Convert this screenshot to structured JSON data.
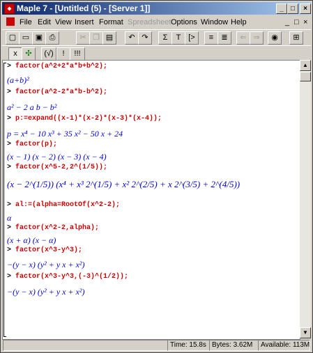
{
  "window": {
    "title": "Maple 7 - [Untitled (5) - [Server 1]]",
    "buttons": {
      "minimize": "_",
      "maximize": "□",
      "close": "×"
    }
  },
  "menu": {
    "items": [
      "File",
      "Edit",
      "View",
      "Insert",
      "Format",
      "Spreadsheet",
      "Options",
      "Window",
      "Help"
    ],
    "disabled": [
      "Spreadsheet"
    ],
    "doc_controls": [
      "_",
      "□",
      "×"
    ]
  },
  "toolbar1": {
    "buttons": [
      {
        "name": "new-document-button",
        "glyph": "▢"
      },
      {
        "name": "open-button",
        "glyph": "▭"
      },
      {
        "name": "save-button",
        "glyph": "▣"
      },
      {
        "name": "print-button",
        "glyph": "⎙"
      },
      {
        "name": "cut-button",
        "glyph": "✂"
      },
      {
        "name": "copy-button",
        "glyph": "❐"
      },
      {
        "name": "paste-button",
        "glyph": "▤"
      },
      {
        "name": "undo-button",
        "glyph": "↶"
      },
      {
        "name": "redo-button",
        "glyph": "↷"
      },
      {
        "name": "insert-math-button",
        "glyph": "Σ"
      },
      {
        "name": "insert-text-button",
        "glyph": "T"
      },
      {
        "name": "insert-prompt-button",
        "glyph": "[>"
      },
      {
        "name": "indent-button",
        "glyph": "≡"
      },
      {
        "name": "outdent-button",
        "glyph": "≣"
      },
      {
        "name": "back-button",
        "glyph": "⇐"
      },
      {
        "name": "forward-button",
        "glyph": "⇒"
      },
      {
        "name": "stop-button",
        "glyph": "◉"
      },
      {
        "name": "restart-button",
        "glyph": "⊞"
      }
    ]
  },
  "toolbar2": {
    "buttons": [
      {
        "name": "maple-notation-button",
        "glyph": "x"
      },
      {
        "name": "standard-math-button",
        "glyph": "✣"
      },
      {
        "name": "execute-button",
        "glyph": "(√)"
      },
      {
        "name": "execute-worksheet-button",
        "glyph": "!"
      },
      {
        "name": "execute-all-button",
        "glyph": "!!!"
      }
    ]
  },
  "worksheet": {
    "lines": [
      {
        "kind": "in",
        "text": "factor(a^2+2*a*b+b^2);"
      },
      {
        "kind": "out",
        "text": "(a+b)²"
      },
      {
        "kind": "in",
        "text": "factor(a^2-2*a*b-b^2);"
      },
      {
        "kind": "out",
        "text": "a² − 2 a b − b²"
      },
      {
        "kind": "in",
        "text": "p:=expand((x-1)*(x-2)*(x-3)*(x-4));"
      },
      {
        "kind": "out",
        "text": "p = x⁴ − 10 x³ + 35 x² − 50 x + 24"
      },
      {
        "kind": "in",
        "text": "factor(p);"
      },
      {
        "kind": "out",
        "text": "(x − 1) (x − 2) (x − 3) (x − 4)"
      },
      {
        "kind": "in",
        "text": "factor(x^5-2,2^(1/5));"
      },
      {
        "kind": "out",
        "text": "(x − 2^(1/5)) (x⁴ + x³ 2^(1/5) + x² 2^(2/5) + x 2^(3/5) + 2^(4/5))"
      },
      {
        "kind": "in",
        "text": "al:=(alpha=RootOf(x^2-2);"
      },
      {
        "kind": "out",
        "text": "α"
      },
      {
        "kind": "in",
        "text": "factor(x^2-2,alpha);"
      },
      {
        "kind": "out",
        "text": "(x + α) (x − α)"
      },
      {
        "kind": "in",
        "text": "factor(x^3-y^3);"
      },
      {
        "kind": "out",
        "text": "−(y − x) (y² + y x + x²)"
      },
      {
        "kind": "in",
        "text": "factor(x^3-y^3,(-3)^(1/2));"
      },
      {
        "kind": "out",
        "text": "−(y − x) (y² + y x + x²)"
      }
    ]
  },
  "status": {
    "time": "Time: 15.8s",
    "bytes": "Bytes: 3.62M",
    "available": "Available: 113M"
  }
}
